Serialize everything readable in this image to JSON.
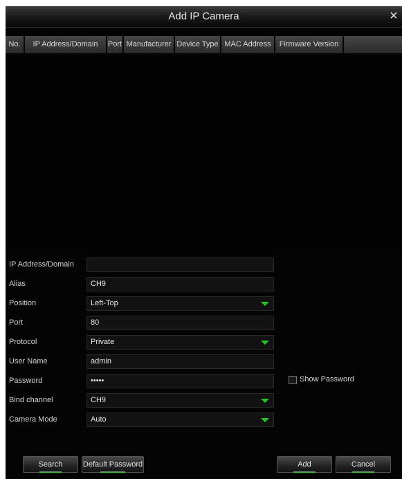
{
  "dialog": {
    "title": "Add IP Camera",
    "close_icon": "×"
  },
  "table": {
    "columns": [
      "No.",
      "IP Address/Domain",
      "Port",
      "Manufacturer",
      "Device Type",
      "MAC Address",
      "Firmware Version",
      ""
    ]
  },
  "form": {
    "ip": {
      "label": "IP Address/Domain",
      "value": ""
    },
    "alias": {
      "label": "Alias",
      "value": "CH9"
    },
    "position": {
      "label": "Position",
      "value": "Left-Top"
    },
    "port": {
      "label": "Port",
      "value": "80"
    },
    "protocol": {
      "label": "Protocol",
      "value": "Private"
    },
    "username": {
      "label": "User Name",
      "value": "admin"
    },
    "password": {
      "label": "Password",
      "value": "•••••",
      "show_label": "Show Password"
    },
    "bind": {
      "label": "Bind channel",
      "value": "CH9"
    },
    "mode": {
      "label": "Camera Mode",
      "value": "Auto"
    }
  },
  "buttons": {
    "search": "Search",
    "default_password": "Default Password",
    "add": "Add",
    "cancel": "Cancel"
  },
  "colors": {
    "accent": "#2fbf2f",
    "background": "#040404"
  }
}
